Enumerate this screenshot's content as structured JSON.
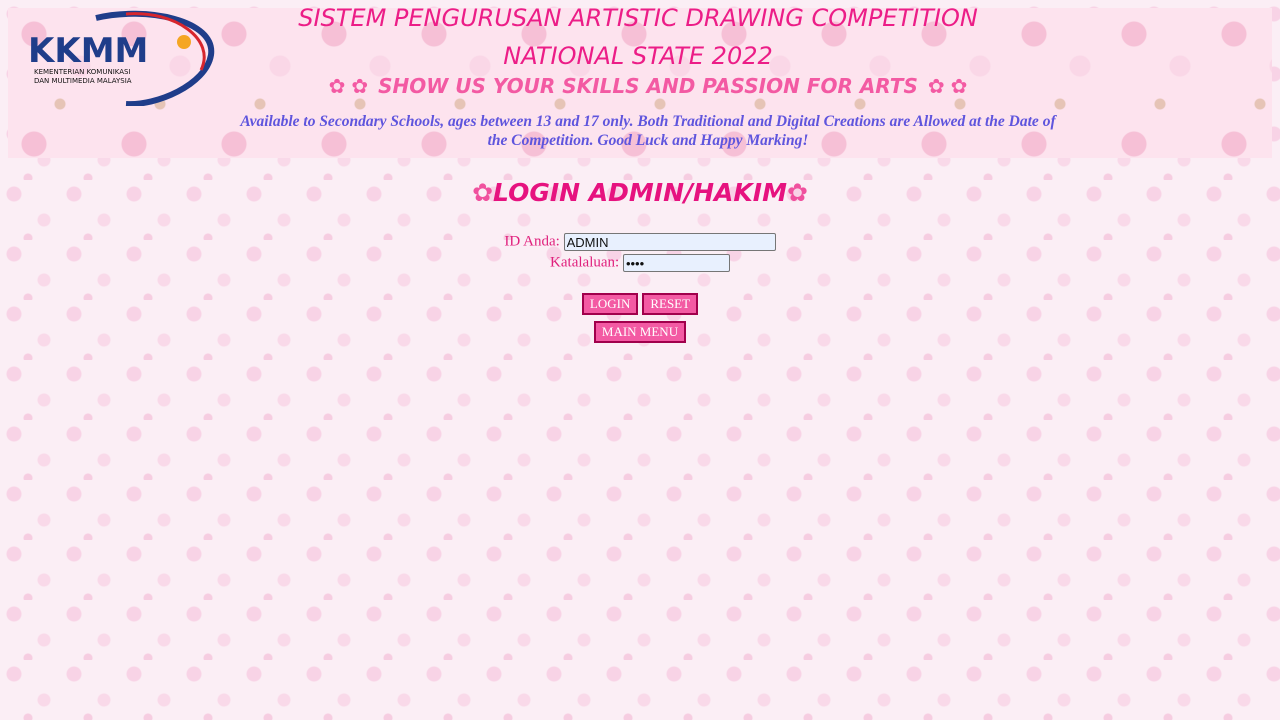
{
  "banner": {
    "logo_text": "KKMM",
    "logo_subtitle_line1": "KEMENTERIAN KOMUNIKASI",
    "logo_subtitle_line2": "DAN MULTIMEDIA MALAYSIA",
    "title_line1": "SISTEM PENGURUSAN ARTISTIC DRAWING COMPETITION",
    "title_line2": "NATIONAL STATE 2022",
    "tagline": "Show us your skills and passion for arts",
    "note": "Available to Secondary Schools, ages between 13 and 17 only. Both Traditional and Digital Creations are Allowed at the Date of the Competition. Good Luck and Happy Marking!"
  },
  "login": {
    "heading": "LOGIN ADMIN/HAKIM",
    "id_label": "ID Anda:",
    "id_value": "ADMIN",
    "password_label": "Katalaluan:",
    "password_value": "••••",
    "login_button": "LOGIN",
    "reset_button": "RESET",
    "main_menu_button": "MAIN MENU"
  },
  "colors": {
    "title_pink": "#ec1d87",
    "note_blue": "#5f55dd",
    "button_fill": "#f35aa3",
    "button_border": "#a1004c",
    "logo_navy": "#1f3d8a",
    "logo_red": "#d7262d",
    "logo_orange": "#f5a623"
  },
  "icons": {
    "decor": "flower-icon"
  }
}
